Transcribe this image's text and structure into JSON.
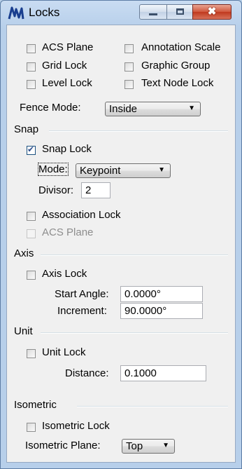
{
  "window": {
    "title": "Locks",
    "minimize_icon": "minimize-icon",
    "maximize_icon": "maximize-icon",
    "close_icon": "close-icon",
    "close_glyph": "✖"
  },
  "general_locks": {
    "acs_plane": {
      "label": "ACS Plane",
      "checked": false
    },
    "annotation_scale": {
      "label": "Annotation Scale",
      "checked": false
    },
    "grid_lock": {
      "label": "Grid Lock",
      "checked": false
    },
    "graphic_group": {
      "label": "Graphic Group",
      "checked": false
    },
    "level_lock": {
      "label": "Level Lock",
      "checked": false
    },
    "text_node_lock": {
      "label": "Text Node Lock",
      "checked": false
    }
  },
  "fence": {
    "label": "Fence Mode:",
    "value": "Inside"
  },
  "snap": {
    "title": "Snap",
    "snap_lock": {
      "label": "Snap Lock",
      "checked": true
    },
    "mode_label": "Mode:",
    "mode_value": "Keypoint",
    "divisor_label": "Divisor:",
    "divisor_value": "2",
    "association_lock": {
      "label": "Association Lock",
      "checked": false
    },
    "acs_plane": {
      "label": "ACS Plane",
      "checked": false,
      "enabled": false
    }
  },
  "axis": {
    "title": "Axis",
    "axis_lock": {
      "label": "Axis Lock",
      "checked": false
    },
    "start_angle_label": "Start Angle:",
    "start_angle_value": "0.0000°",
    "increment_label": "Increment:",
    "increment_value": "90.0000°"
  },
  "unit": {
    "title": "Unit",
    "unit_lock": {
      "label": "Unit Lock",
      "checked": false
    },
    "distance_label": "Distance:",
    "distance_value": "0.1000"
  },
  "isometric": {
    "title": "Isometric",
    "isometric_lock": {
      "label": "Isometric Lock",
      "checked": false
    },
    "plane_label": "Isometric Plane:",
    "plane_value": "Top"
  },
  "dropdown_glyph": "▼"
}
